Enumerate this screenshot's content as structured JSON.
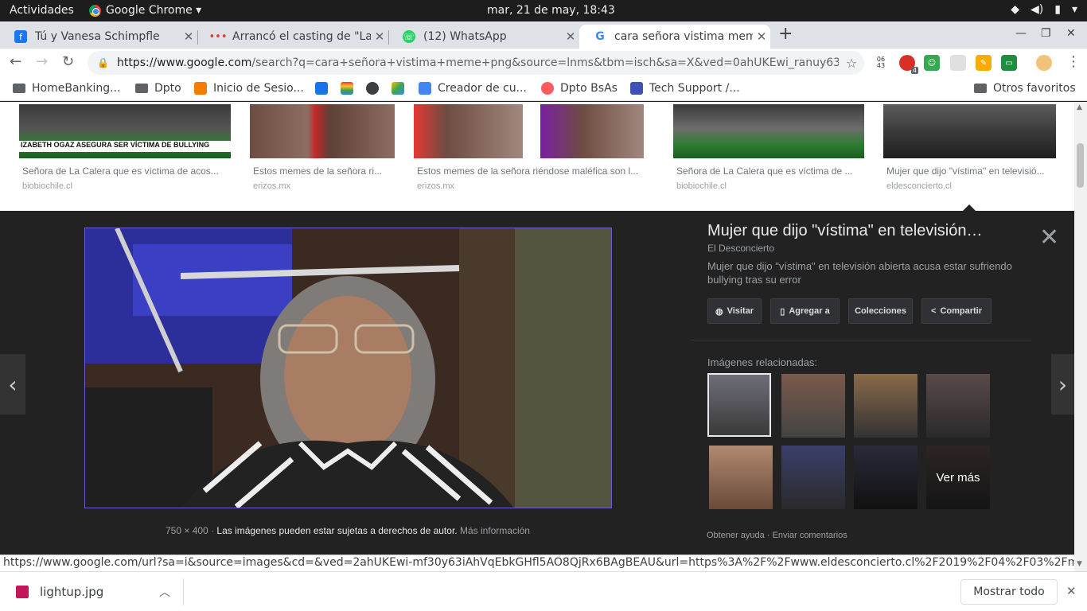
{
  "topbar": {
    "activities": "Actividades",
    "app_name": "Google Chrome ▾",
    "clock": "mar, 21 de may, 18:43",
    "sys_icons": [
      "wifi-icon",
      "volume-icon",
      "battery-icon",
      "power-menu-icon"
    ]
  },
  "tabs": [
    {
      "title": "Tú y Vanesa Schimpfle",
      "favicon": "facebook-icon",
      "color": "#1877f2"
    },
    {
      "title": "Arrancó el casting de \"La V",
      "favicon": "dots-icon",
      "color": "#e53935"
    },
    {
      "title": "(12) WhatsApp",
      "favicon": "whatsapp-icon",
      "color": "#25d366"
    },
    {
      "title": "cara señora vistima meme",
      "favicon": "google-icon",
      "color": "#4285f4"
    }
  ],
  "omnibox": {
    "url_host": "https://www.google.com",
    "url_rest": "/search?q=cara+señora+vistima+meme+png&source=lnms&tbm=isch&sa=X&ved=0ahUKEwi_ranuy63iAhWQGbkGH..."
  },
  "extensions": {
    "clock_badge": "06\n43",
    "badge_count": "4"
  },
  "bookmarks": [
    {
      "label": "HomeBanking...",
      "icon": "folder"
    },
    {
      "label": "Dpto",
      "icon": "folder"
    },
    {
      "label": "Inicio de Sesio...",
      "icon": "bookmark-site-icon"
    },
    {
      "label": "",
      "icon": "cy-icon"
    },
    {
      "label": "",
      "icon": "palette-icon"
    },
    {
      "label": "",
      "icon": "globe-icon"
    },
    {
      "label": "",
      "icon": "drive-icon"
    },
    {
      "label": "Creador de cu...",
      "icon": "filter-icon"
    },
    {
      "label": "Dpto BsAs",
      "icon": "airbnb-icon"
    },
    {
      "label": "Tech Support /...",
      "icon": "tech-support-icon"
    }
  ],
  "other_bookmarks": "Otros favoritos",
  "results": [
    {
      "caption": "Señora de La Calera que es víctima de acos...",
      "domain": "biobiochile.cl"
    },
    {
      "caption": "Estos memes de la señora ri...",
      "domain": "erizos.mx"
    },
    {
      "caption": "Estos memes de la señora riéndose maléfica son l...",
      "domain": "erizos.mx"
    },
    {
      "caption": "Señora de La Calera que es víctima de ...",
      "domain": "biobiochile.cl"
    },
    {
      "caption": "Mujer que dijo \"vístima\" en televisió...",
      "domain": "eldesconcierto.cl"
    }
  ],
  "thumb_banner": "IZABETH OGAZ ASEGURA SER VÍCTIMA DE BULLYING",
  "viewer": {
    "title": "Mujer que dijo \"vístima\" en televisión…",
    "source": "El Desconcierto",
    "description": "Mujer que dijo \"vístima\" en televisión abierta acusa estar sufriendo bullying tras su error",
    "buttons": {
      "visit": "Visitar",
      "save": "Agregar a",
      "collections": "Colecciones",
      "share": "Compartir"
    },
    "related_label": "Imágenes relacionadas:",
    "see_more": "Ver más",
    "dimensions": "750 × 400",
    "copyright": "Las imágenes pueden estar sujetas a derechos de autor.",
    "more_info": "Más información",
    "help": "Obtener ayuda",
    "feedback": "Enviar comentarios"
  },
  "status_url": "https://www.google.com/url?sa=i&source=images&cd=&ved=2ahUKEwi-mf30y63iAhVqEbkGHfl5AO8QjRx6BAgBEAU&url=https%3A%2F%2Fwww.eldesconcierto.cl%2F2019%2F04%2F03%2Fmuj...",
  "downloads": {
    "file": "lightup.jpg",
    "show_all": "Mostrar todo"
  }
}
